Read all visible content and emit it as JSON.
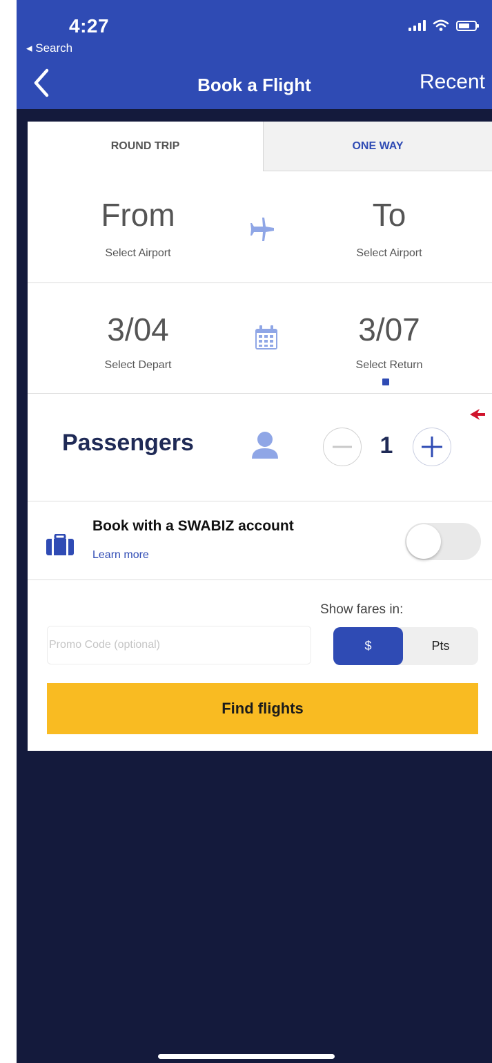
{
  "status_bar": {
    "time": "4:27",
    "back_app": "◂ Search"
  },
  "nav": {
    "title": "Book a Flight",
    "recent_label": "Recent"
  },
  "tabs": [
    {
      "label": "ROUND TRIP",
      "selected": true
    },
    {
      "label": "ONE WAY",
      "selected": false
    }
  ],
  "route": {
    "from_label": "From",
    "from_sub": "Select Airport",
    "to_label": "To",
    "to_sub": "Select Airport"
  },
  "dates": {
    "depart_value": "3/04",
    "depart_sub": "Select Depart",
    "return_value": "3/07",
    "return_sub": "Select Return"
  },
  "passengers": {
    "label": "Passengers",
    "count": "1"
  },
  "swabiz": {
    "title": "Book with a SWABIZ account",
    "learn_more": "Learn more",
    "toggle_on": false
  },
  "fares": {
    "promo_placeholder": "Promo Code (optional)",
    "show_fares_label": "Show fares in:",
    "options": [
      "$",
      "Pts"
    ],
    "selected": "$"
  },
  "find_button": "Find flights",
  "colors": {
    "brand_blue": "#2f4bb4",
    "navy": "#141a3c",
    "cta_yellow": "#f9bb22"
  }
}
